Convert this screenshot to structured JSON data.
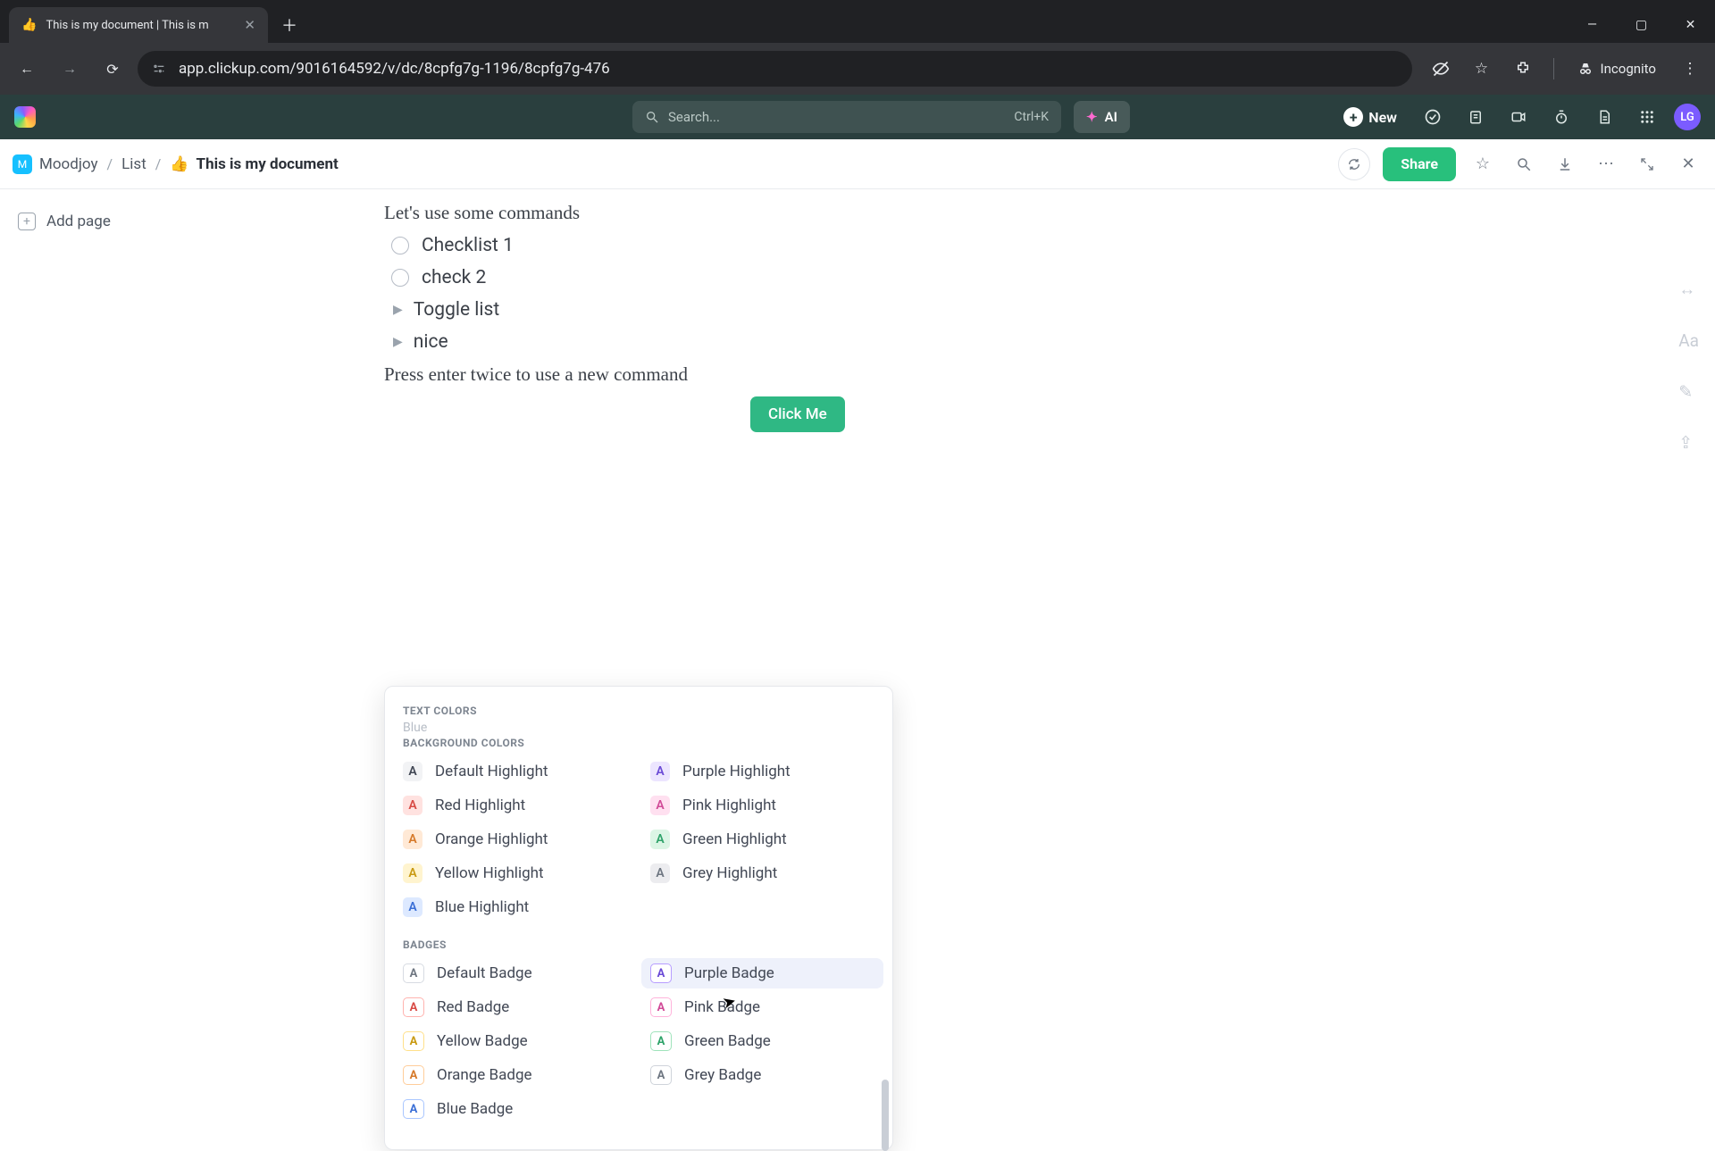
{
  "browser": {
    "tab_title": "This is my document | This is m",
    "tab_favicon": "👍",
    "url": "app.clickup.com/9016164592/v/dc/8cpfg7g-1196/8cpfg7g-476",
    "incognito_label": "Incognito"
  },
  "topbar": {
    "search_placeholder": "Search...",
    "search_shortcut": "Ctrl+K",
    "ai_label": "AI",
    "new_label": "New",
    "avatar_initials": "LG"
  },
  "breadcrumbs": {
    "space": "Moodjoy",
    "list": "List",
    "doc_emoji": "👍",
    "doc_title": "This is my document",
    "share_label": "Share"
  },
  "sidebar": {
    "add_page_label": "Add page"
  },
  "document": {
    "heading": "Let's use some commands",
    "checklist": [
      "Checklist 1",
      "check 2"
    ],
    "toggles": [
      "Toggle list",
      "nice"
    ],
    "hint": "Press enter twice to use a new command",
    "button_label": "Click Me"
  },
  "popover": {
    "section_text_colors": "TEXT COLORS",
    "truncated_item": "Blue",
    "section_bg": "BACKGROUND COLORS",
    "highlights": [
      {
        "label": "Default Highlight",
        "bg": "#f2f3f5",
        "fg": "#424855"
      },
      {
        "label": "Purple Highlight",
        "bg": "#ece5ff",
        "fg": "#6b4bd6"
      },
      {
        "label": "Red Highlight",
        "bg": "#ffe2e0",
        "fg": "#d84b45"
      },
      {
        "label": "Pink Highlight",
        "bg": "#ffe0f0",
        "fg": "#d14b98"
      },
      {
        "label": "Orange Highlight",
        "bg": "#ffe9d6",
        "fg": "#d67a2b"
      },
      {
        "label": "Green Highlight",
        "bg": "#dcf5e5",
        "fg": "#2fa36a"
      },
      {
        "label": "Yellow Highlight",
        "bg": "#fff4cf",
        "fg": "#c99a12"
      },
      {
        "label": "Grey Highlight",
        "bg": "#ececef",
        "fg": "#6f7782"
      },
      {
        "label": "Blue Highlight",
        "bg": "#dde9ff",
        "fg": "#3b6fd6"
      }
    ],
    "section_badges": "BADGES",
    "badges": [
      {
        "label": "Default Badge",
        "border": "#d7dbe2",
        "fg": "#6f7782"
      },
      {
        "label": "Purple Badge",
        "border": "#b79dff",
        "fg": "#6b4bd6",
        "hover": true
      },
      {
        "label": "Red Badge",
        "border": "#ffb3af",
        "fg": "#d84b45"
      },
      {
        "label": "Pink Badge",
        "border": "#ffb3db",
        "fg": "#d14b98"
      },
      {
        "label": "Yellow Badge",
        "border": "#ffe08a",
        "fg": "#c99a12"
      },
      {
        "label": "Green Badge",
        "border": "#9fe3bb",
        "fg": "#2fa36a"
      },
      {
        "label": "Orange Badge",
        "border": "#ffcd9a",
        "fg": "#d67a2b"
      },
      {
        "label": "Grey Badge",
        "border": "#cfd3da",
        "fg": "#6f7782"
      },
      {
        "label": "Blue Badge",
        "border": "#a9c6ff",
        "fg": "#3b6fd6"
      }
    ]
  }
}
